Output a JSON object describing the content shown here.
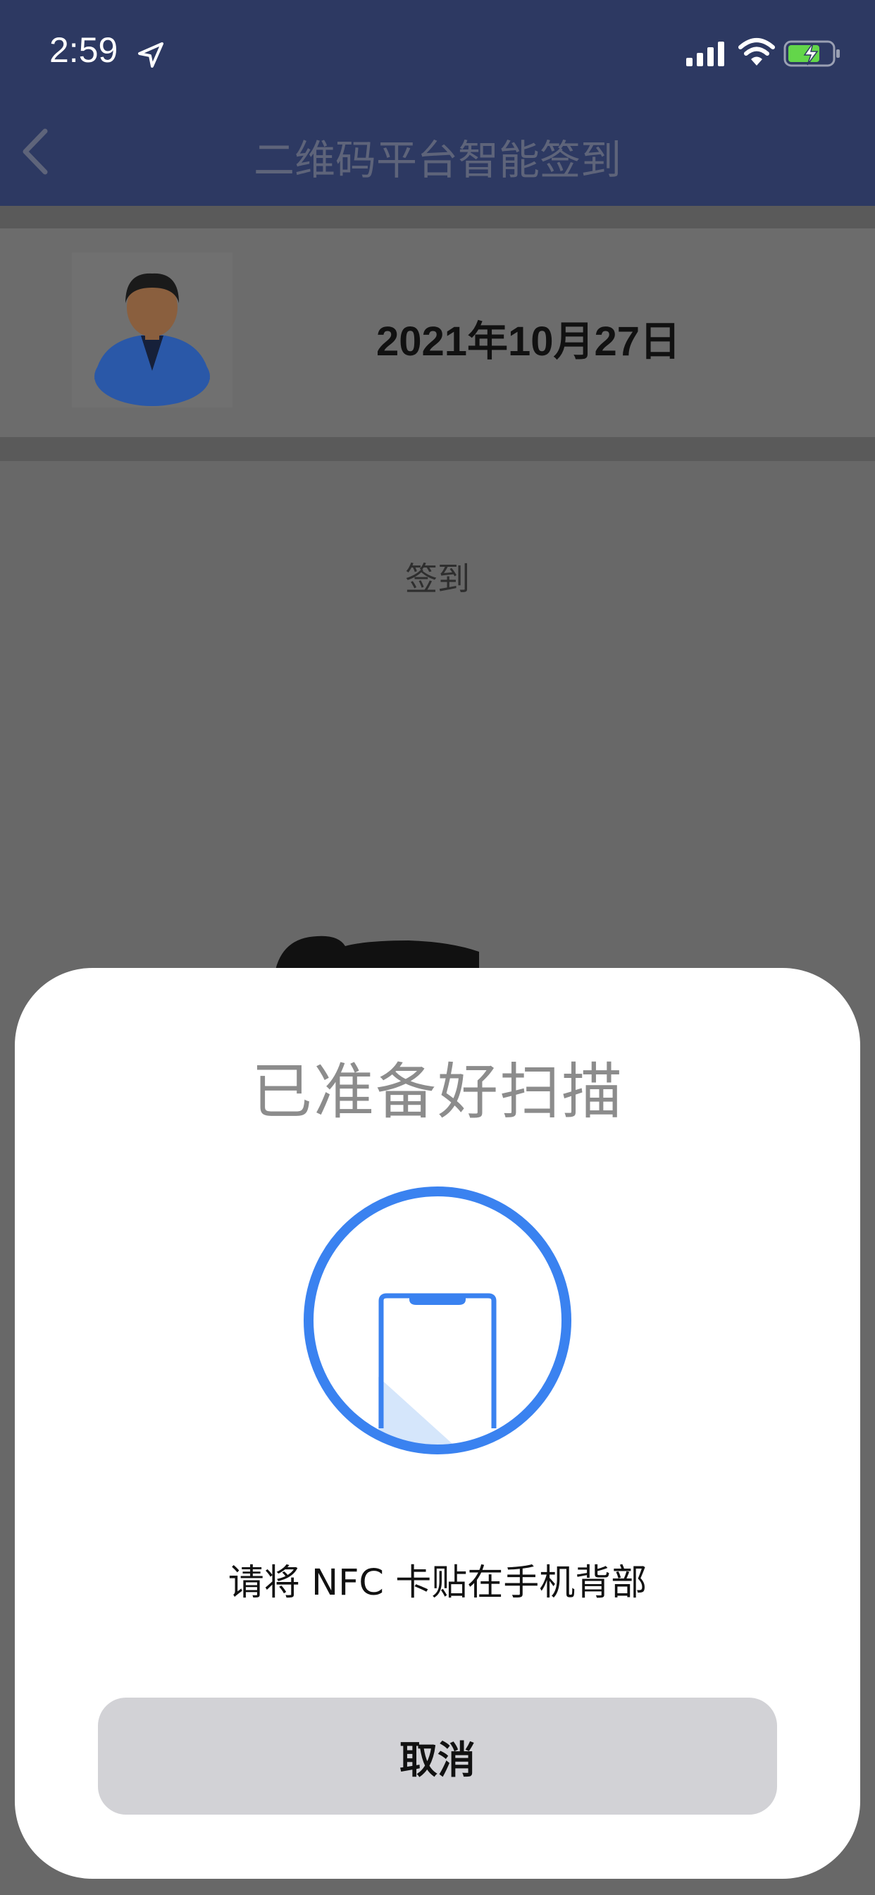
{
  "status_bar": {
    "time": "2:59",
    "icons": [
      "location-arrow-icon",
      "cellular-signal-icon",
      "wifi-icon",
      "battery-charging-icon"
    ]
  },
  "nav": {
    "back_icon": "chevron-left-icon",
    "title": "二维码平台智能签到"
  },
  "profile": {
    "avatar_icon": "user-avatar-icon",
    "date": "2021年10月27日"
  },
  "main": {
    "signin_label": "签到"
  },
  "nfc_sheet": {
    "title": "已准备好扫描",
    "icon": "phone-nfc-icon",
    "instruction": "请将 NFC 卡贴在手机背部",
    "cancel_label": "取消"
  },
  "colors": {
    "nav_bar": "#2d3962",
    "dim_overlay": "#686868",
    "sheet_bg": "#ffffff",
    "accent_blue": "#3a82f0",
    "battery_green": "#63d64a",
    "cancel_button": "#d2d2d6"
  }
}
